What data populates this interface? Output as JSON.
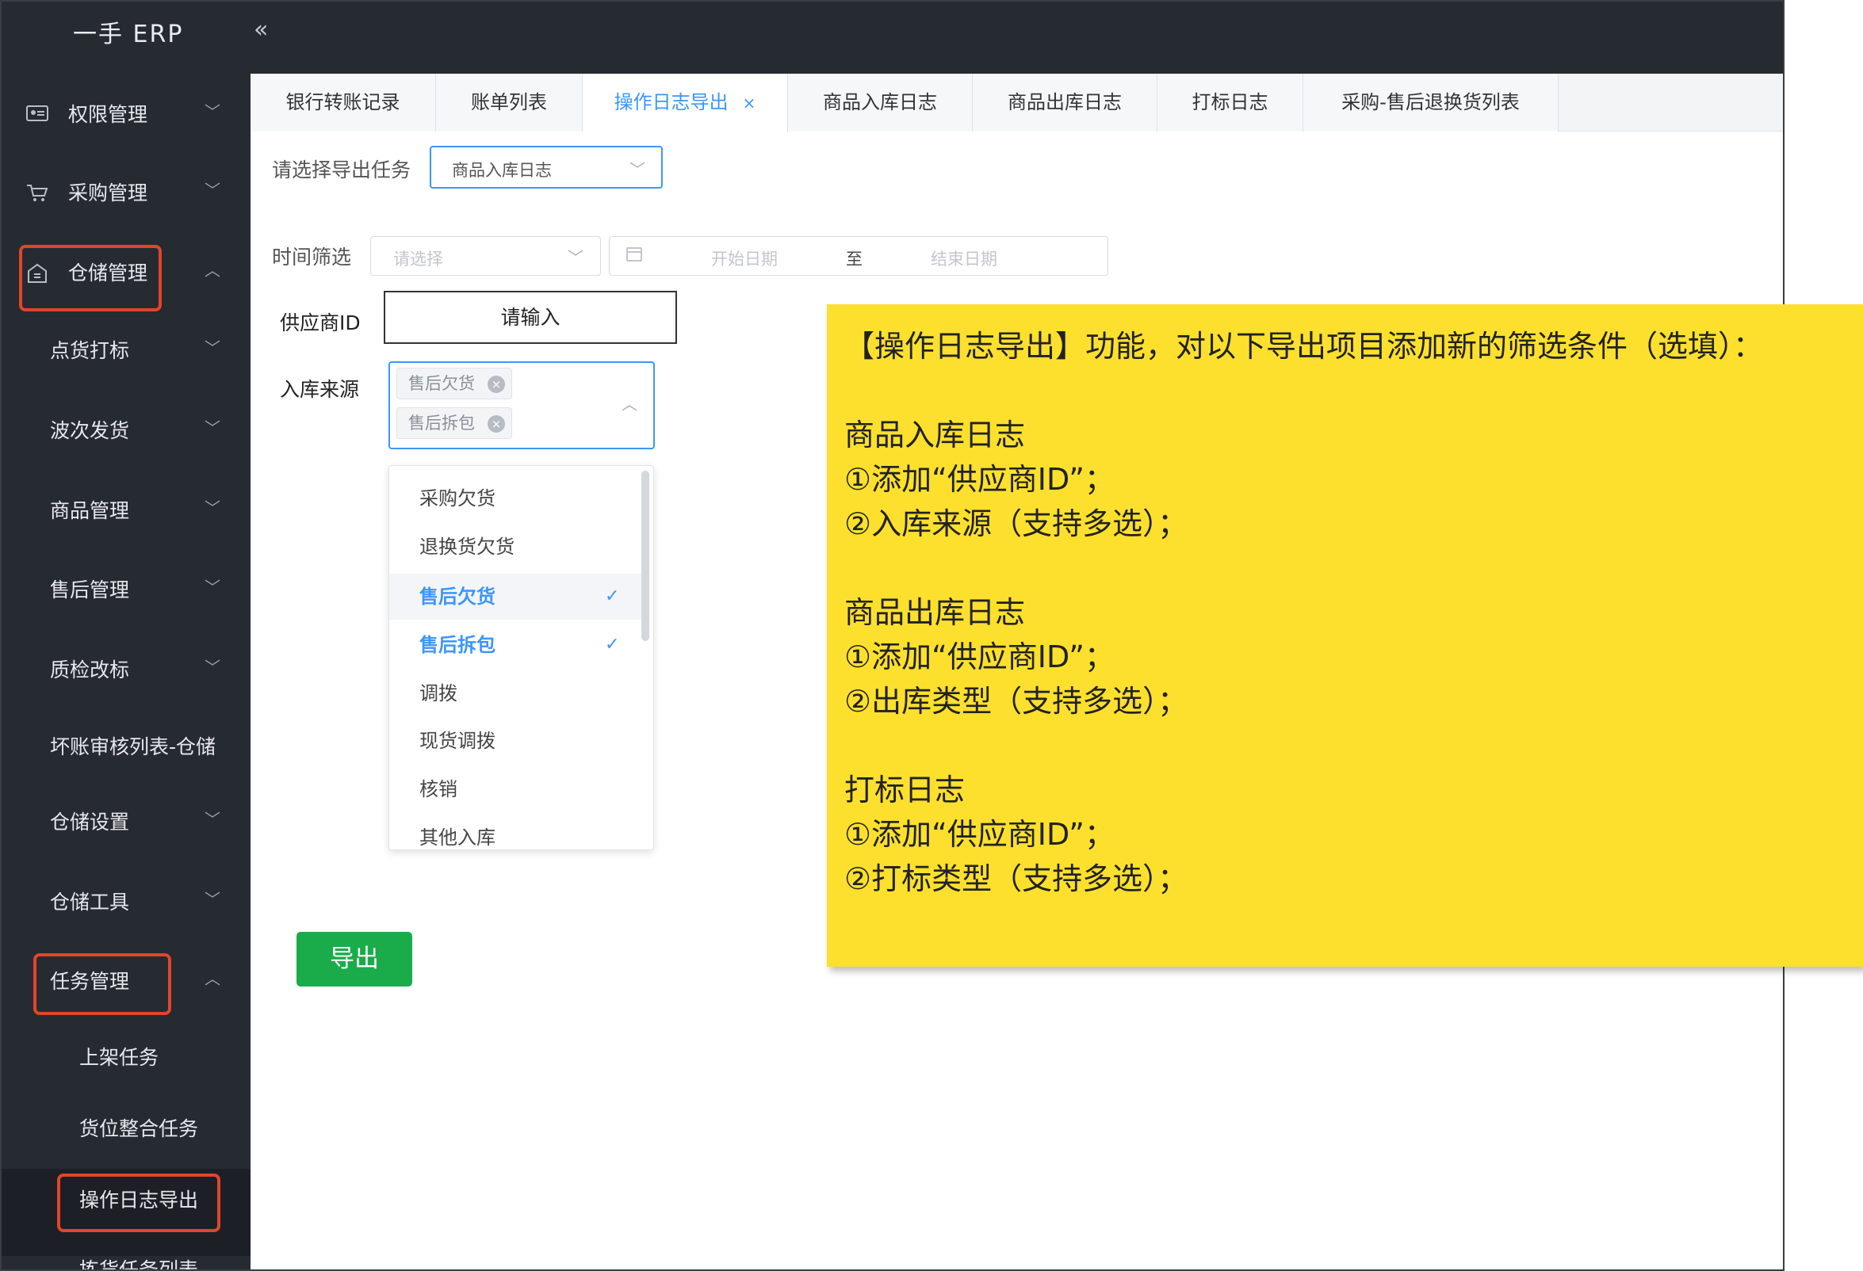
{
  "header": {
    "app_title": "一手 ERP",
    "collapse_icon": "double-chevron-left-icon"
  },
  "sidebar": {
    "items": [
      {
        "label": "权限管理",
        "icon": "id-card-icon",
        "expanded": false
      },
      {
        "label": "采购管理",
        "icon": "cart-icon",
        "expanded": false
      },
      {
        "label": "仓储管理",
        "icon": "warehouse-icon",
        "expanded": true
      },
      {
        "label": "点货打标"
      },
      {
        "label": "波次发货"
      },
      {
        "label": "商品管理"
      },
      {
        "label": "售后管理"
      },
      {
        "label": "质检改标"
      },
      {
        "label": "坏账审核列表-仓储"
      },
      {
        "label": "仓储设置"
      },
      {
        "label": "仓储工具"
      },
      {
        "label": "任务管理",
        "expanded": true
      },
      {
        "label": "上架任务"
      },
      {
        "label": "货位整合任务"
      },
      {
        "label": "操作日志导出",
        "active": true
      },
      {
        "label": "拣货任务列表"
      }
    ]
  },
  "tabs": [
    {
      "label": "银行转账记录"
    },
    {
      "label": "账单列表"
    },
    {
      "label": "操作日志导出",
      "active": true,
      "close": "×"
    },
    {
      "label": "商品入库日志"
    },
    {
      "label": "商品出库日志"
    },
    {
      "label": "打标日志"
    },
    {
      "label": "采购-售后退换货列表"
    }
  ],
  "form": {
    "task_label": "请选择导出任务",
    "task_value": "商品入库日志",
    "time_label": "时间筛选",
    "time_placeholder": "请选择",
    "start_date_placeholder": "开始日期",
    "date_separator": "至",
    "end_date_placeholder": "结束日期",
    "supplier_label": "供应商ID",
    "supplier_placeholder": "请输入",
    "source_label": "入库来源",
    "source_tags": [
      "售后欠货",
      "售后拆包"
    ],
    "source_options": [
      {
        "label": "采购欠货",
        "selected": false
      },
      {
        "label": "退换货欠货",
        "selected": false
      },
      {
        "label": "售后欠货",
        "selected": true
      },
      {
        "label": "售后拆包",
        "selected": true
      },
      {
        "label": "调拨",
        "selected": false
      },
      {
        "label": "现货调拨",
        "selected": false
      },
      {
        "label": "核销",
        "selected": false
      },
      {
        "label": "其他入库",
        "selected": false
      }
    ],
    "export_button": "导出"
  },
  "note": {
    "lines": [
      "【操作日志导出】功能，对以下导出项目添加新的筛选条件（选填）：",
      "商品入库日志",
      "①添加“供应商ID”；",
      "②入库来源（支持多选）；",
      "商品出库日志",
      "①添加“供应商ID”；",
      "②出库类型（支持多选）；",
      "打标日志",
      "①添加“供应商ID”；",
      "②打标类型（支持多选）；"
    ]
  },
  "colors": {
    "sidebar_bg": "#262a31",
    "accent": "#3c96f7",
    "highlight_red": "#e2452b",
    "export_green": "#1aab4a",
    "note_yellow": "#fde02d"
  }
}
